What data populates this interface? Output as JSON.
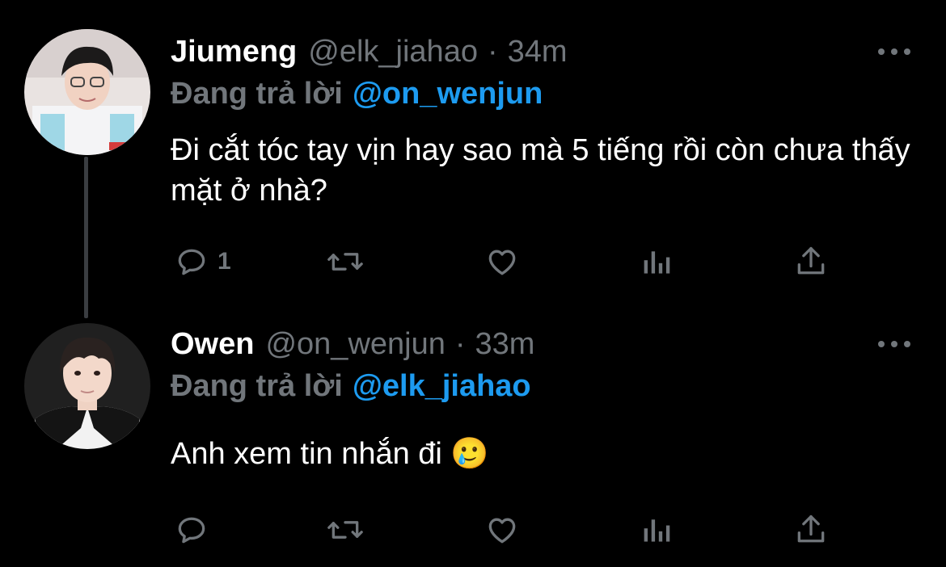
{
  "tweets": [
    {
      "display_name": "Jiumeng",
      "handle": "@elk_jiahao",
      "separator": "·",
      "time": "34m",
      "reply_label": "Đang trả lời",
      "reply_to": "@on_wenjun",
      "text": "Đi cắt tóc tay vịn hay sao mà 5 tiếng rồi còn chưa thấy mặt ở nhà?",
      "reply_count": "1"
    },
    {
      "display_name": "Owen",
      "handle": "@on_wenjun",
      "separator": "·",
      "time": "33m",
      "reply_label": "Đang trả lời",
      "reply_to": "@elk_jiahao",
      "text": "Anh xem tin nhắn đi 🥲",
      "reply_count": ""
    }
  ],
  "icons": {
    "reply": "reply-icon",
    "retweet": "retweet-icon",
    "like": "heart-icon",
    "views": "views-icon",
    "share": "share-icon",
    "more": "more-icon"
  },
  "colors": {
    "background": "#000000",
    "name": "#ffffff",
    "muted": "#71767b",
    "link": "#1d9bf0",
    "thread_line": "#3a3d41"
  }
}
